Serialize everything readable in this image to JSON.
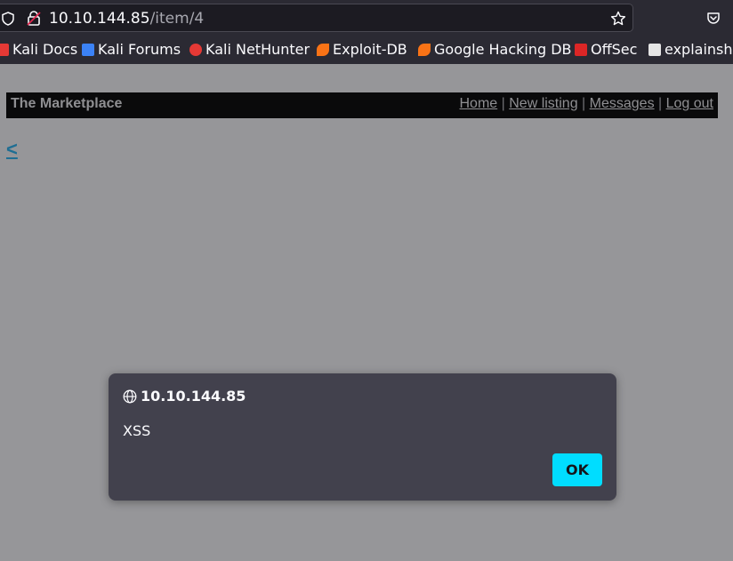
{
  "browser": {
    "url_host": "10.10.144.85",
    "url_path": "/item/4",
    "bookmarks": [
      {
        "label": "Kali Docs",
        "icon": "kali-docs-icon",
        "color": "#e53935"
      },
      {
        "label": "Kali Forums",
        "icon": "kali-forums-icon",
        "color": "#3b82f6"
      },
      {
        "label": "Kali NetHunter",
        "icon": "kali-nethunter-icon",
        "color": "#e53935"
      },
      {
        "label": "Exploit-DB",
        "icon": "exploit-db-icon",
        "color": "#f97316"
      },
      {
        "label": "Google Hacking DB",
        "icon": "ghdb-icon",
        "color": "#f97316"
      },
      {
        "label": "OffSec",
        "icon": "offsec-icon",
        "color": "#dc2626"
      },
      {
        "label": "explainshell",
        "icon": "explainshell-icon",
        "color": "#e5e5e5"
      }
    ]
  },
  "site": {
    "title": "The Marketplace",
    "nav": {
      "home": "Home",
      "new_listing": "New listing",
      "messages": "Messages",
      "logout": "Log out",
      "separator": " | "
    },
    "back_link": "<"
  },
  "dialog": {
    "origin": "10.10.144.85",
    "message": "XSS",
    "ok_label": "OK"
  },
  "colors": {
    "accent": "#00ddff",
    "dialog_bg": "#42414d",
    "page_overlay": "#969699"
  }
}
